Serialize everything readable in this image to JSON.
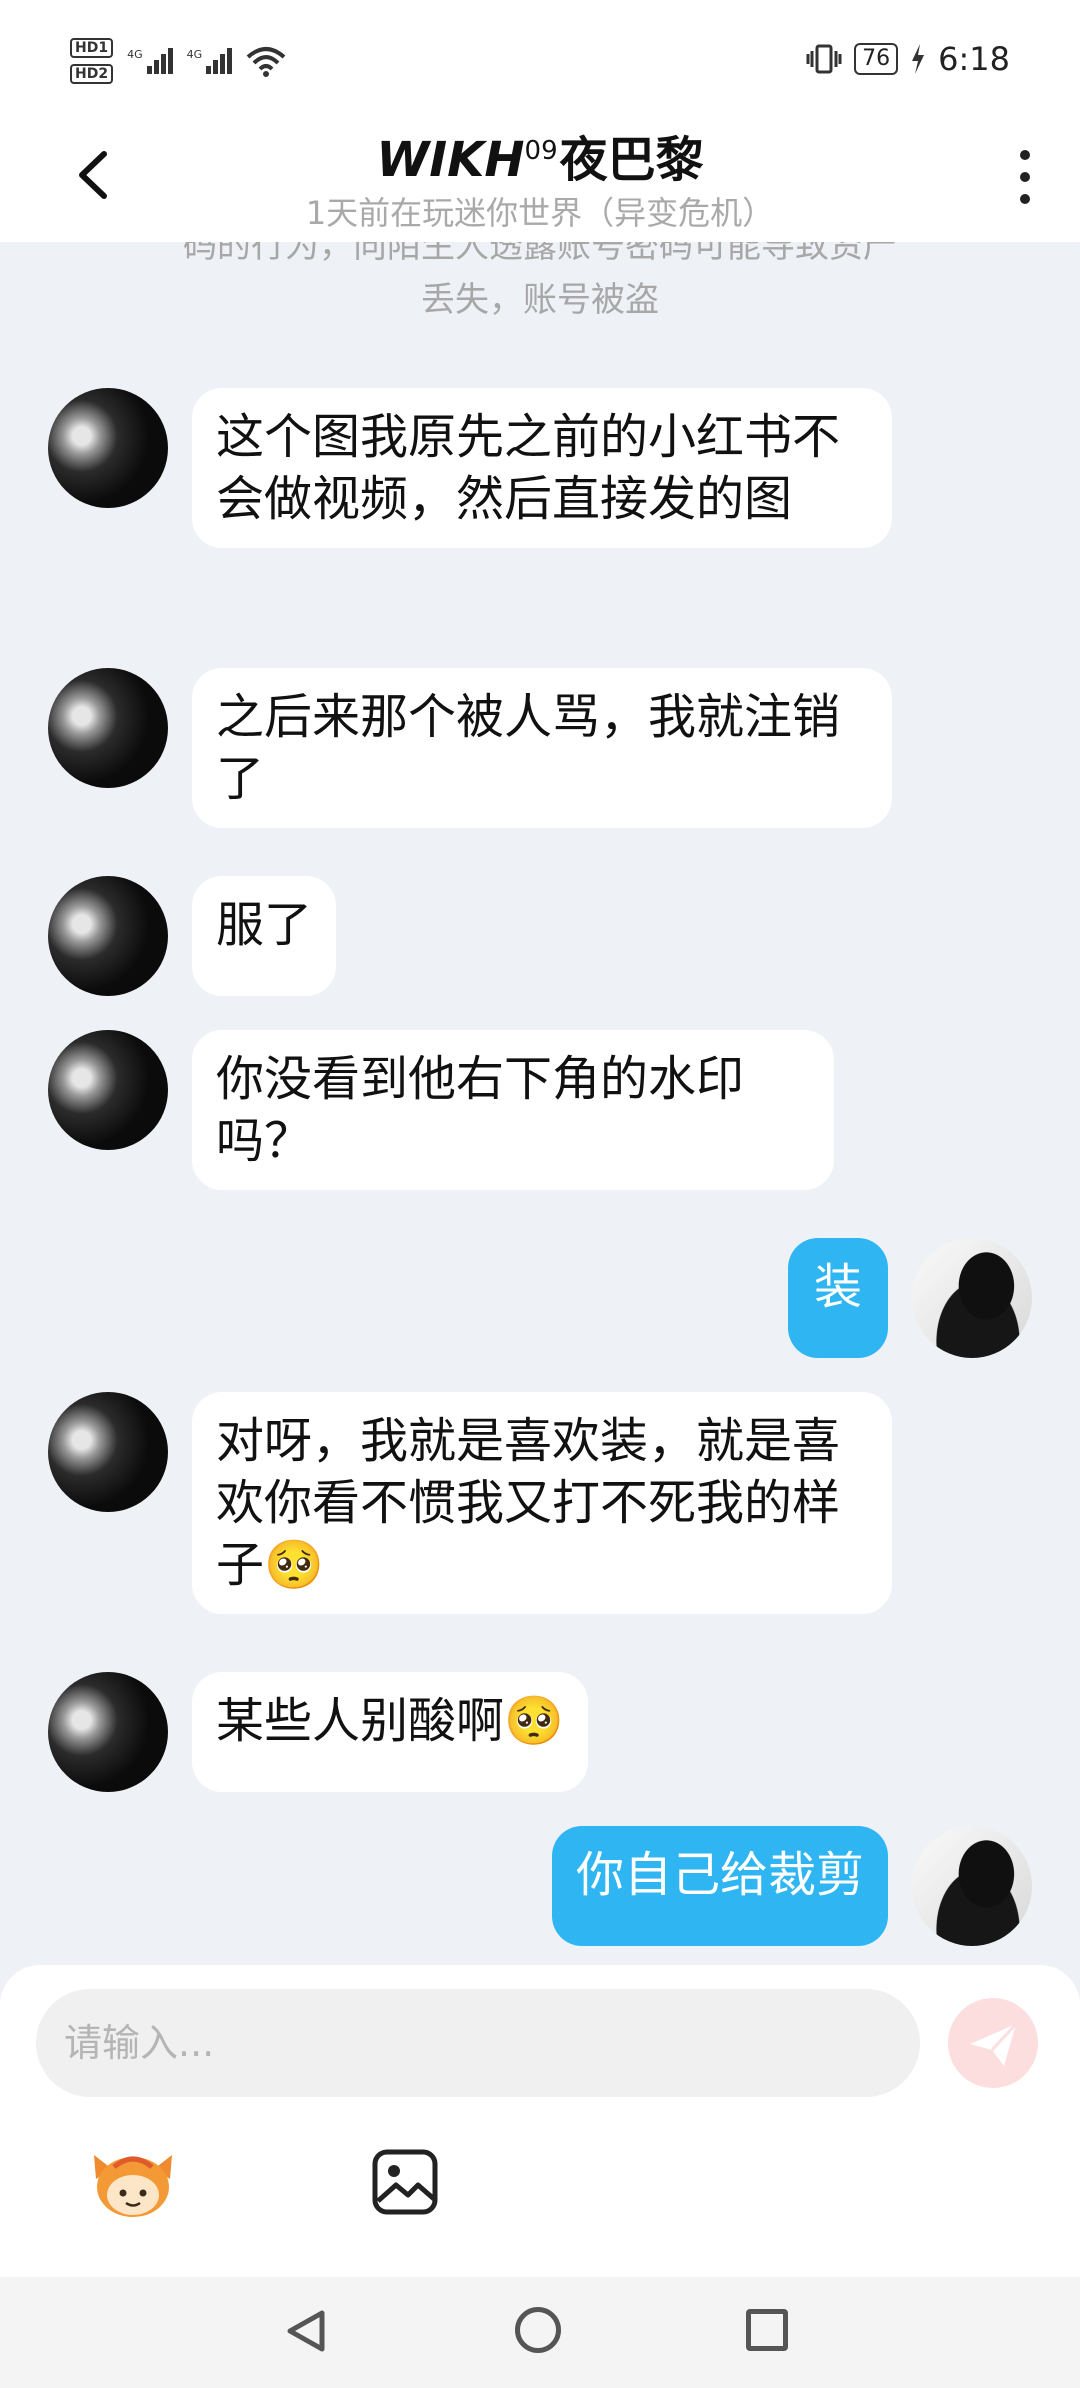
{
  "status_bar": {
    "hd1": "HD1",
    "hd2": "HD2",
    "net1": "4G",
    "net2": "4G",
    "battery": "76",
    "time": "6:18"
  },
  "header": {
    "title_main": "WIKH",
    "title_sup": "09",
    "title_rest": "夜巴黎",
    "subtitle": "1天前在玩迷你世界（异变危机）"
  },
  "system_tip": {
    "line1": "码的行为，向陌生人透露账号密码可能导致资产",
    "line2": "丢失，账号被盗"
  },
  "messages": [
    {
      "side": "left",
      "text": "这个图我原先之前的小红书不会做视频，然后直接发的图"
    },
    {
      "side": "left",
      "text": "之后来那个被人骂，我就注销了"
    },
    {
      "side": "left",
      "text": "服了"
    },
    {
      "side": "left",
      "text": "你没看到他右下角的水印吗？"
    },
    {
      "side": "right",
      "text": "装"
    },
    {
      "side": "left",
      "text": "对呀，我就是喜欢装，就是喜欢你看不惯我又打不死我的样子🥺"
    },
    {
      "side": "left",
      "text": "某些人别酸啊🥺"
    },
    {
      "side": "right",
      "text": "你自己给裁剪"
    }
  ],
  "composer": {
    "placeholder": "请输入..."
  },
  "icons": {
    "back": "chevron-left-icon",
    "more": "more-vertical-icon",
    "send": "send-icon",
    "emoji": "mascot-emoji-icon",
    "image": "image-icon"
  },
  "colors": {
    "my_bubble": "#2fb6f2",
    "background": "#eef2f7",
    "send_button": "#fcdede"
  }
}
